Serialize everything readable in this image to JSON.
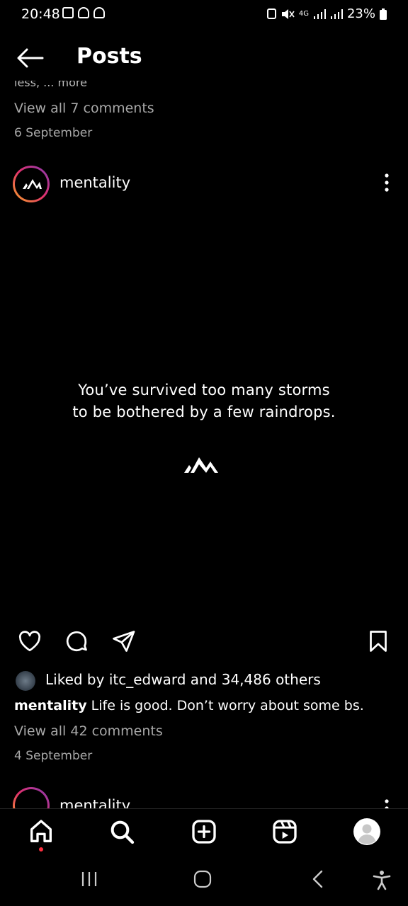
{
  "status": {
    "time": "20:48",
    "network": "4G",
    "battery": "23%"
  },
  "header": {
    "title": "Posts"
  },
  "previous_post": {
    "cut_text": "less, ... more",
    "view_comments": "View all 7 comments",
    "date": "6 September"
  },
  "post": {
    "username": "mentality",
    "quote_line1": "You’ve survived too many storms",
    "quote_line2": "to be bothered by a few raindrops.",
    "liked_by": "Liked by itc_edward and 34,486 others",
    "caption_user": "mentality",
    "caption_text": "Life is good. Don’t worry about some bs.",
    "view_comments": "View all 42 comments",
    "date": "4 September"
  },
  "next_post": {
    "username": "mentality"
  },
  "icons": {
    "back": "arrow-left-icon",
    "more": "more-vertical-icon",
    "like": "heart-icon",
    "comment": "comment-icon",
    "share": "send-icon",
    "save": "bookmark-icon",
    "home": "home-icon",
    "search": "search-icon",
    "create": "plus-square-icon",
    "reels": "reels-icon",
    "profile": "avatar-icon"
  },
  "colors": {
    "background": "#000000",
    "text": "#ffffff",
    "secondary_text": "#a8a8a8",
    "notification_dot": "#ff3040"
  }
}
